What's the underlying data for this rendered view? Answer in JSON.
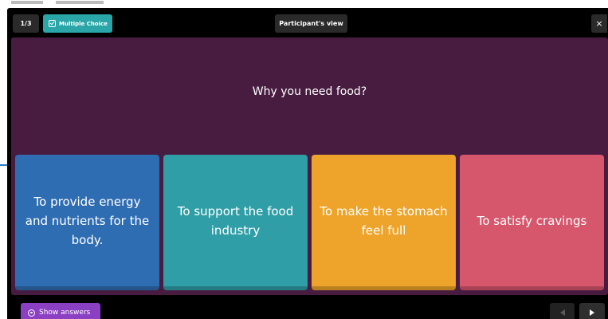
{
  "header": {
    "counter": "1/3",
    "question_type": "Multiple Choice",
    "view_label": "Participant's view",
    "close_symbol": "×"
  },
  "slide": {
    "question": "Why you need food?",
    "options": [
      {
        "label": "To provide energy and nutrients for the body.",
        "color": "#2f6db3"
      },
      {
        "label": "To support the food industry",
        "color": "#2f9ea6"
      },
      {
        "label": "To make the stomach feel full",
        "color": "#eea42a"
      },
      {
        "label": "To satisfy cravings",
        "color": "#d6566c"
      }
    ],
    "background": "#471c40"
  },
  "footer": {
    "show_answers_label": "Show answers",
    "accent": "#8b3fc2"
  },
  "icons": {
    "type_icon": "checkbox-icon",
    "show_answers_icon": "eye-icon",
    "prev_icon": "triangle-left-icon",
    "next_icon": "triangle-right-icon"
  }
}
